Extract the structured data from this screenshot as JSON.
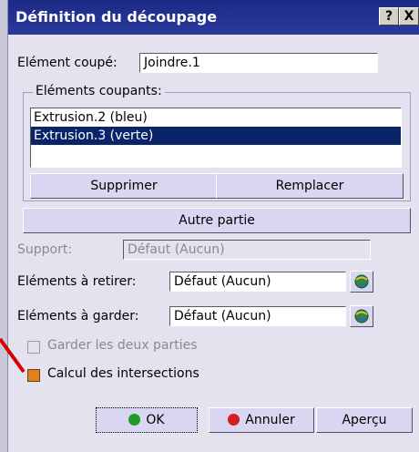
{
  "dialog": {
    "title": "Définition du découpage",
    "help_label": "?",
    "close_label": "X"
  },
  "element_coupe": {
    "label": "Elément coupé:",
    "value": "Joindre.1"
  },
  "cutting_elements": {
    "legend": "Eléments coupants:",
    "items": [
      {
        "label": "Extrusion.2 (bleu)",
        "selected": false
      },
      {
        "label": "Extrusion.3 (verte)",
        "selected": true
      }
    ]
  },
  "buttons": {
    "supprimer": "Supprimer",
    "remplacer": "Remplacer",
    "autre_partie": "Autre partie",
    "ok": "OK",
    "annuler": "Annuler",
    "apercu": "Aperçu"
  },
  "support": {
    "label": "Support:",
    "value": "Défaut (Aucun)"
  },
  "retirer": {
    "label": "Eléments à retirer:",
    "value": "Défaut (Aucun)"
  },
  "garder": {
    "label": "Eléments à garder:",
    "value": "Défaut (Aucun)"
  },
  "options": {
    "garder_deux": {
      "label": "Garder les deux parties",
      "checked": false,
      "enabled": false
    },
    "calcul_intersections": {
      "label": "Calcul des intersections",
      "checked": true,
      "enabled": true
    }
  },
  "colors": {
    "titlebar": "#1c2a86",
    "selection": "#0a246a",
    "ok_dot": "#1e9a28",
    "annuler_dot": "#d42020",
    "callout": "#d40000"
  },
  "icons": {
    "pick": "globe-selector-icon"
  }
}
